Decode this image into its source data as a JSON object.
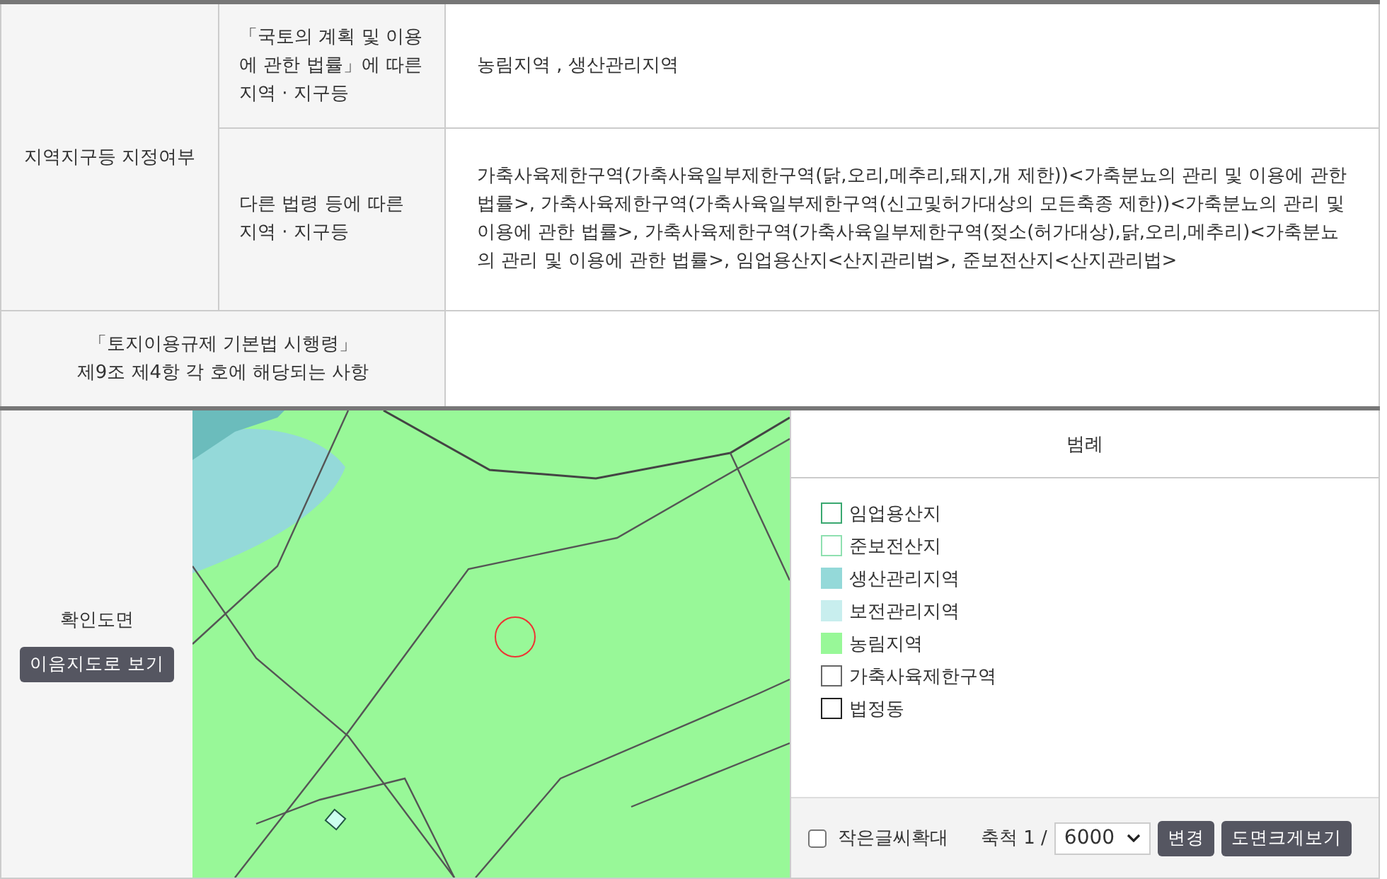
{
  "zoning": {
    "label": "지역지구등 지정여부",
    "rows": [
      {
        "label": "「국토의 계획 및 이용에 관한 법률」에 따른 지역 · 지구등",
        "value": "농림지역 , 생산관리지역"
      },
      {
        "label": "다른 법령 등에 따른 지역 · 지구등",
        "value": "가축사육제한구역(가축사육일부제한구역(닭,오리,메추리,돼지,개 제한))<가축분뇨의 관리 및 이용에 관한 법률>, 가축사육제한구역(가축사육일부제한구역(신고및허가대상의 모든축종 제한))<가축분뇨의 관리 및 이용에 관한 법률>, 가축사육제한구역(가축사육일부제한구역(젖소(허가대상),닭,오리,메추리)<가축분뇨의 관리 및 이용에 관한 법률>, 임업용산지<산지관리법>, 준보전산지<산지관리법>"
      }
    ]
  },
  "decree": {
    "label_lines": [
      "「토지이용규제 기본법 시행령」",
      "제9조 제4항 각 호에 해당되는 사항"
    ]
  },
  "map_section": {
    "label": "확인도면",
    "button": "이음지도로 보기",
    "legend": {
      "title": "범례",
      "items": [
        {
          "label": "임업용산지",
          "kind": "outline",
          "color": "#3aa870"
        },
        {
          "label": "준보전산지",
          "kind": "outline",
          "color": "#8fe0b0"
        },
        {
          "label": "생산관리지역",
          "kind": "fill",
          "color": "#94d9d9"
        },
        {
          "label": "보전관리지역",
          "kind": "fill",
          "color": "#c8eeee"
        },
        {
          "label": "농림지역",
          "kind": "fill",
          "color": "#98f898"
        },
        {
          "label": "가축사육제한구역",
          "kind": "outline",
          "color": "#666666"
        },
        {
          "label": "법정동",
          "kind": "outline",
          "color": "#222222"
        }
      ]
    },
    "controls": {
      "enlarge_text": {
        "label": "작은글씨확대",
        "checked": false
      },
      "scale_label": "축척 1 /",
      "scale_value": "6000",
      "change_button": "변경",
      "enlarge_button": "도면크게보기"
    }
  }
}
